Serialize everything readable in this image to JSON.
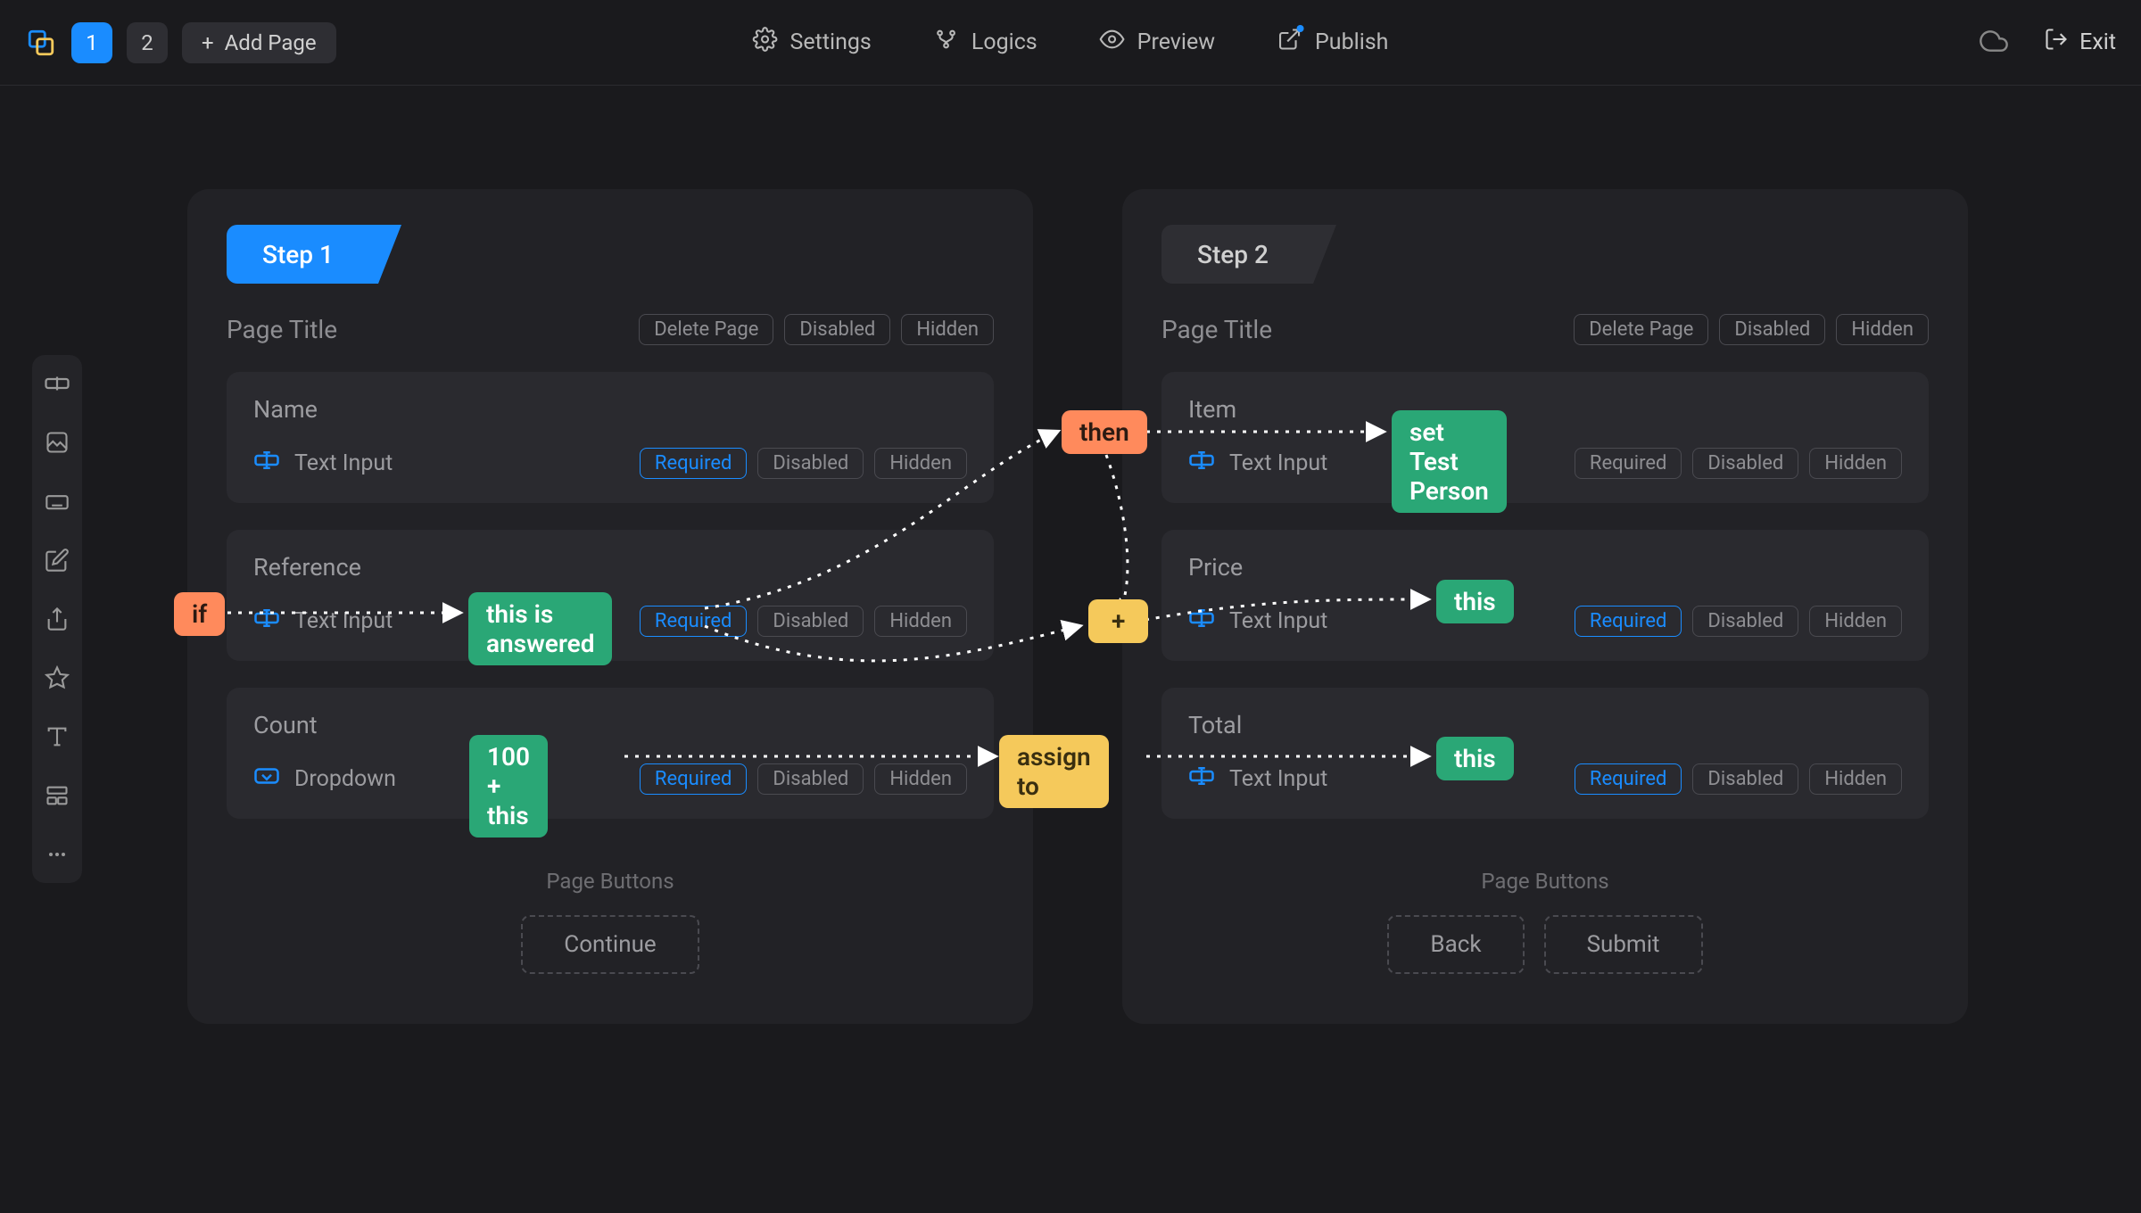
{
  "topbar": {
    "pages": [
      "1",
      "2"
    ],
    "active_page_index": 0,
    "add_page": "Add Page",
    "links": {
      "settings": "Settings",
      "logics": "Logics",
      "preview": "Preview",
      "publish": "Publish"
    },
    "exit": "Exit"
  },
  "toolrail_icons": [
    "text-input",
    "image",
    "keyboard",
    "edit",
    "export",
    "star",
    "text",
    "layout",
    "more"
  ],
  "panels": [
    {
      "step_label": "Step 1",
      "active": true,
      "page_title": "Page Title",
      "page_actions": {
        "delete": "Delete Page",
        "disabled": "Disabled",
        "hidden": "Hidden"
      },
      "fields": [
        {
          "name": "Name",
          "type": "Text Input",
          "type_icon": "text-input",
          "required": true,
          "disabled": false,
          "hidden": false
        },
        {
          "name": "Reference",
          "type": "Text Input",
          "type_icon": "text-input",
          "required": true,
          "disabled": false,
          "hidden": false
        },
        {
          "name": "Count",
          "type": "Dropdown",
          "type_icon": "dropdown",
          "required": true,
          "disabled": false,
          "hidden": false
        }
      ],
      "page_buttons_label": "Page Buttons",
      "buttons": [
        "Continue"
      ]
    },
    {
      "step_label": "Step 2",
      "active": false,
      "page_title": "Page Title",
      "page_actions": {
        "delete": "Delete Page",
        "disabled": "Disabled",
        "hidden": "Hidden"
      },
      "fields": [
        {
          "name": "Item",
          "type": "Text Input",
          "type_icon": "text-input",
          "required": false,
          "disabled": false,
          "hidden": false
        },
        {
          "name": "Price",
          "type": "Text Input",
          "type_icon": "text-input",
          "required": true,
          "disabled": false,
          "hidden": false
        },
        {
          "name": "Total",
          "type": "Text Input",
          "type_icon": "text-input",
          "required": true,
          "disabled": false,
          "hidden": false
        }
      ],
      "page_buttons_label": "Page Buttons",
      "buttons": [
        "Back",
        "Submit"
      ]
    }
  ],
  "chips": {
    "required": "Required",
    "disabled": "Disabled",
    "hidden": "Hidden"
  },
  "logic_tokens": {
    "if": "if",
    "this_is_answered": "this is answered",
    "then": "then",
    "set_test_person": "set Test Person",
    "plus": "+",
    "this1": "this",
    "hundred_plus_this": "100 + this",
    "assign_to": "assign to",
    "this2": "this"
  },
  "colors": {
    "accent": "#1a8cff",
    "green": "#2aa776",
    "orange": "#ff8a5c",
    "yellow": "#f5c95b"
  }
}
